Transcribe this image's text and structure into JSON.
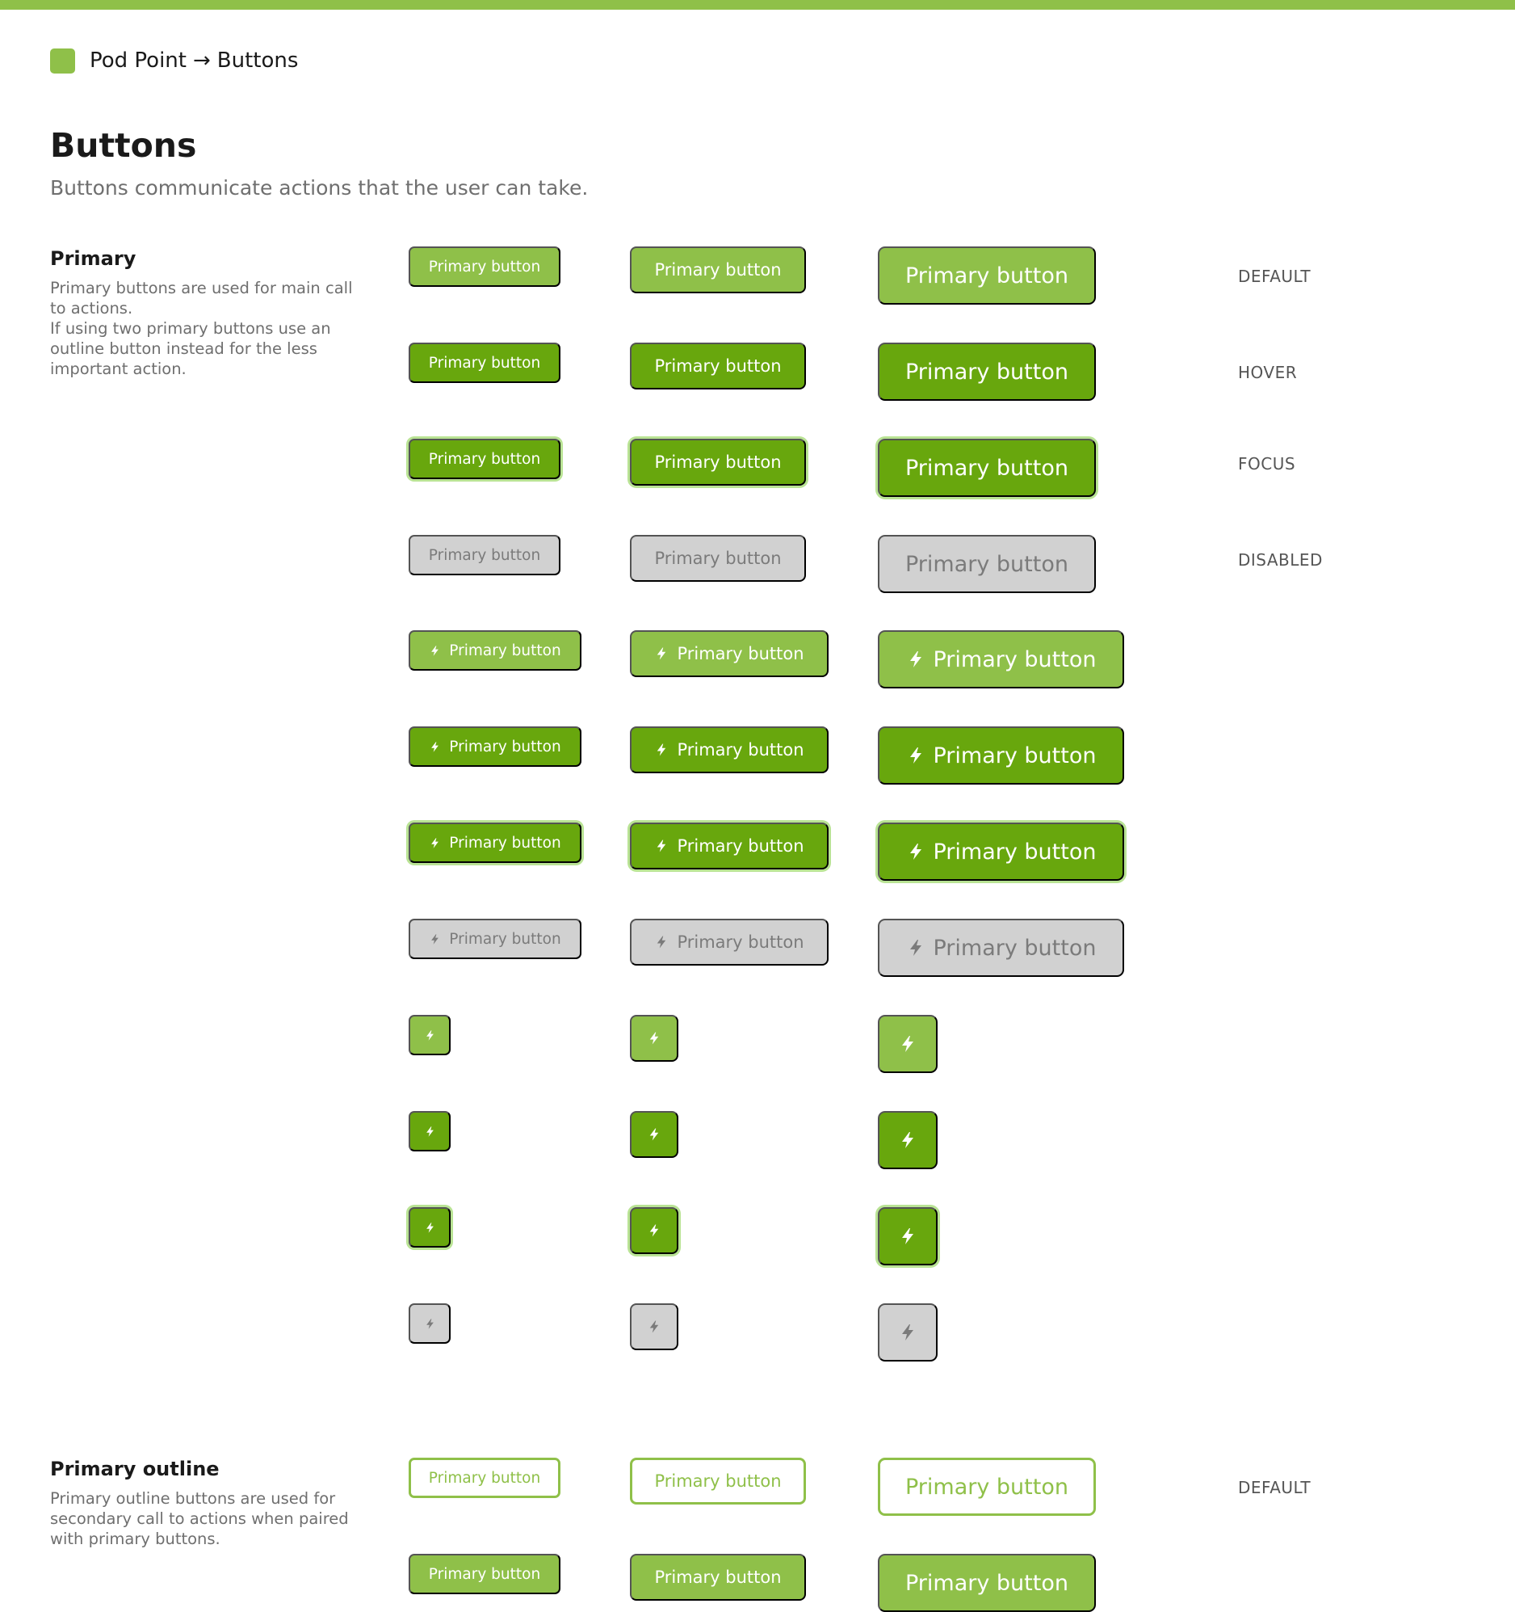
{
  "breadcrumb": {
    "product": "Pod Point",
    "arrow": "→",
    "current": "Buttons"
  },
  "page": {
    "title": "Buttons",
    "subtitle": "Buttons communicate actions that the user can take."
  },
  "sections": {
    "primary": {
      "title": "Primary",
      "description": "Primary buttons are used for main call to actions.\nIf using two primary buttons use an outline button instead for the less important action."
    },
    "primary_outline": {
      "title": "Primary outline",
      "description": "Primary outline buttons are used for secondary call to actions when paired with primary buttons."
    }
  },
  "states": {
    "default": "DEFAULT",
    "hover": "HOVER",
    "focus": "FOCUS",
    "disabled": "DISABLED"
  },
  "button": {
    "label": "Primary button",
    "icon": "lightning-bolt-icon"
  },
  "colors": {
    "brand": "#8fc049",
    "hover": "#68a70d",
    "focus_ring": "#b9e394",
    "disabled_bg": "#d1d1d1",
    "disabled_text": "#7b7b7b"
  }
}
